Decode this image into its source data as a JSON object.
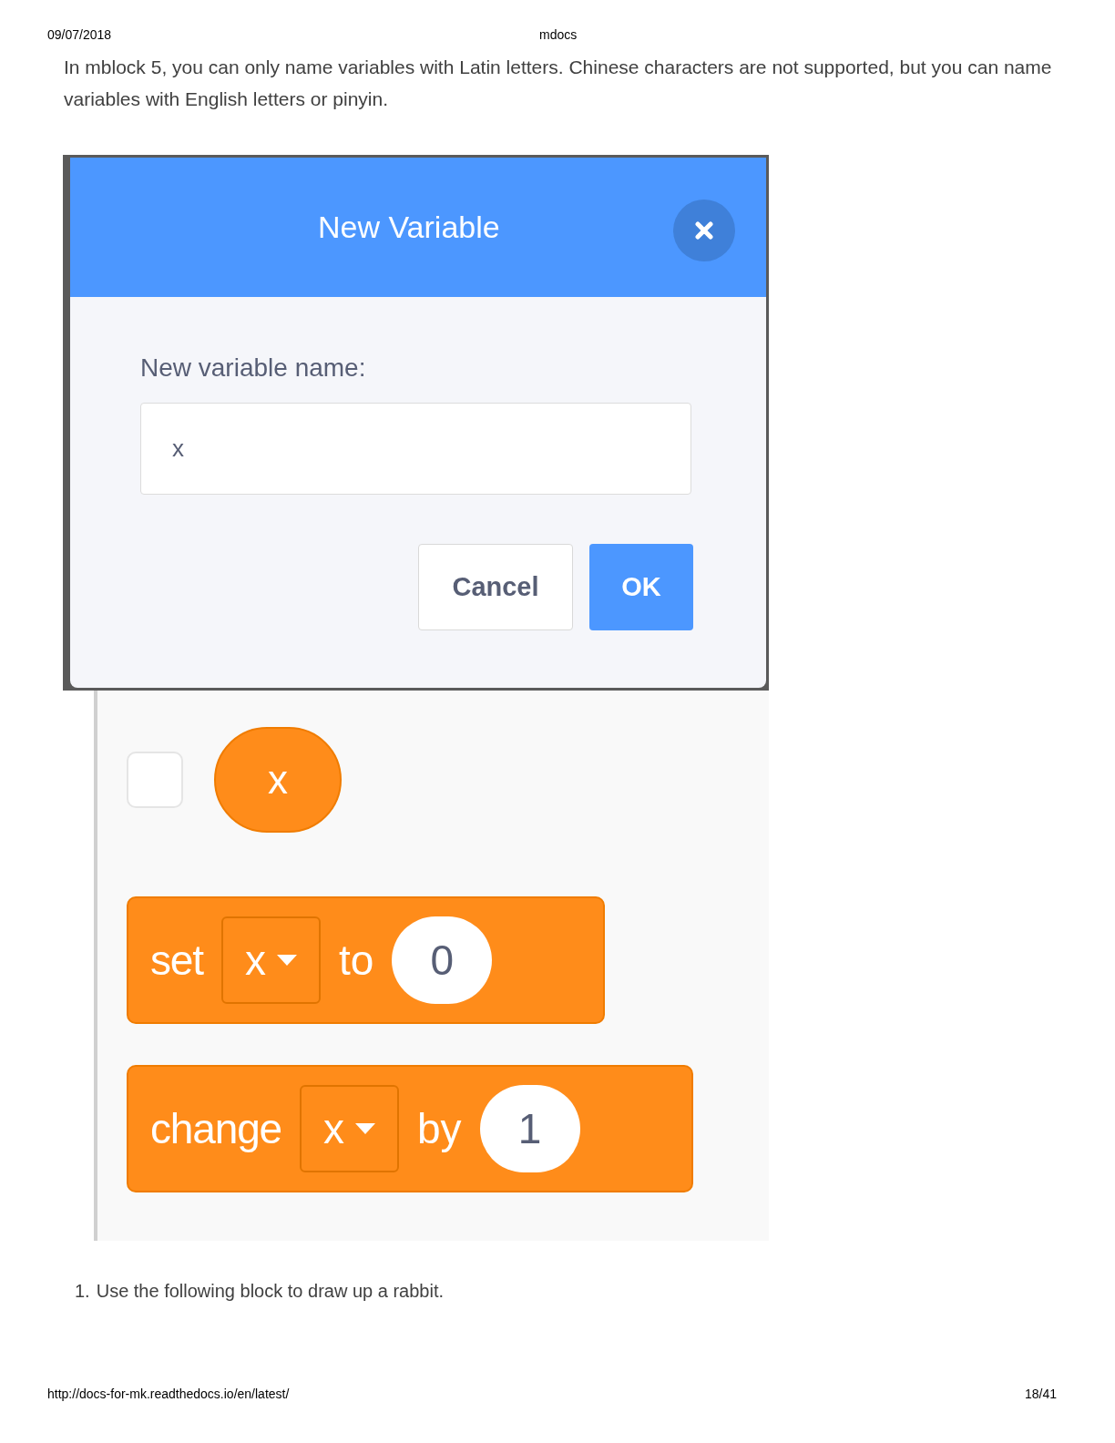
{
  "header": {
    "date": "09/07/2018",
    "title": "mdocs"
  },
  "intro": "In mblock 5, you can only name variables with Latin letters. Chinese characters are not supported, but you can name variables with English letters or pinyin.",
  "dialog": {
    "title": "New Variable",
    "label": "New variable name:",
    "value": "x",
    "buttons": [
      {
        "label": "Cancel",
        "kind": "secondary"
      },
      {
        "label": "OK",
        "kind": "primary"
      }
    ]
  },
  "palette": {
    "variable": {
      "name": "x",
      "checked": false
    },
    "blocks": [
      {
        "verb": "set",
        "variable": "x",
        "preposition": "to",
        "value": "0"
      },
      {
        "verb": "change",
        "variable": "x",
        "preposition": "by",
        "value": "1"
      }
    ]
  },
  "steps": [
    {
      "number": "1.",
      "text": "Use the following block to draw up a rabbit."
    }
  ],
  "footer": {
    "url": "http://docs-for-mk.readthedocs.io/en/latest/",
    "page": "18/41"
  }
}
